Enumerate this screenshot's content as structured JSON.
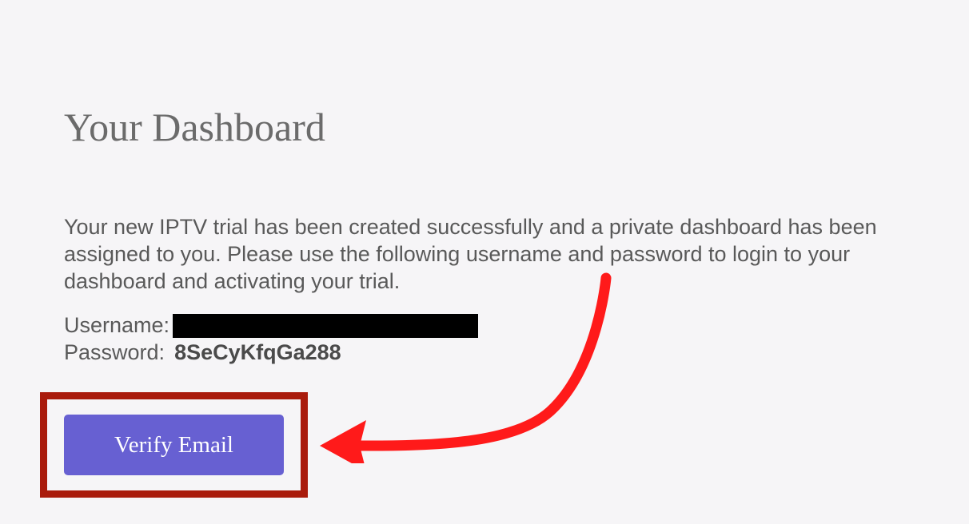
{
  "page": {
    "title": "Your Dashboard",
    "intro": "Your new IPTV trial has been created successfully and a private dashboard has been assigned to you. Please use the following username and password to login to your dashboard and activating your trial."
  },
  "credentials": {
    "username_label": "Username:",
    "password_label": "Password:",
    "password_value": "8SeCyKfqGa288"
  },
  "actions": {
    "verify_email_label": "Verify Email"
  },
  "annotation": {
    "highlight_color": "#a91b0c",
    "arrow_color": "#ff1a1a"
  }
}
